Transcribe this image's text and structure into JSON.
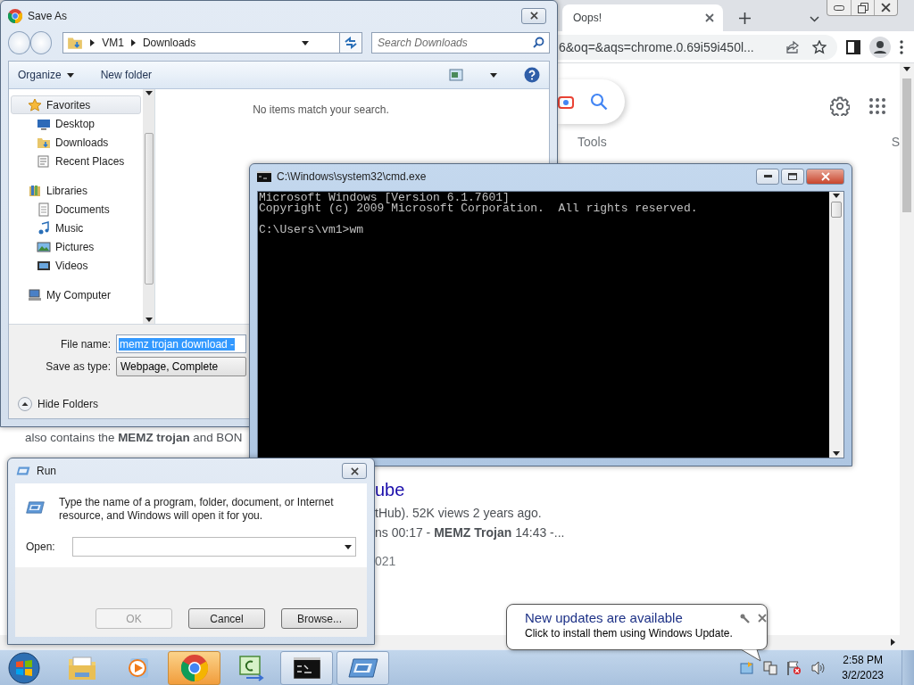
{
  "browser": {
    "tab": {
      "title": "Oops!"
    },
    "address": "6&oq=&aqs=chrome.0.69i59i450l...",
    "page": {
      "tools_link": "Tools",
      "cut_tab": "S",
      "snippet": "also contains the **MEMZ trojan** and BON",
      "result_title": "ube",
      "result_meta": "tHub). 52K views 2 years ago.",
      "result_chapters": "ns 00:17 - **MEMZ Trojan** 14:43 -...",
      "result_date": "021"
    }
  },
  "save_as": {
    "title": "Save As",
    "path": [
      "VM1",
      "Downloads"
    ],
    "search": {
      "placeholder": "Search Downloads"
    },
    "toolbar": {
      "organize": "Organize",
      "new_folder": "New folder"
    },
    "nav": [
      {
        "label": "Favorites",
        "kind": "favorites",
        "selected": true,
        "children": [
          {
            "label": "Desktop",
            "kind": "desktop",
            "selected": false
          },
          {
            "label": "Downloads",
            "kind": "downloads",
            "selected": false
          },
          {
            "label": "Recent Places",
            "kind": "recent",
            "selected": false
          }
        ]
      },
      {
        "label": "Libraries",
        "kind": "libraries",
        "selected": false,
        "children": [
          {
            "label": "Documents",
            "kind": "documents",
            "selected": false
          },
          {
            "label": "Music",
            "kind": "music",
            "selected": false
          },
          {
            "label": "Pictures",
            "kind": "pictures",
            "selected": false
          },
          {
            "label": "Videos",
            "kind": "videos",
            "selected": false
          }
        ]
      },
      {
        "label": "My Computer",
        "kind": "computer",
        "selected": false
      }
    ],
    "empty_message": "No items match your search.",
    "file_name": {
      "label": "File name:",
      "value": "memz trojan download -"
    },
    "save_type": {
      "label": "Save as type:",
      "value": "Webpage, Complete"
    },
    "hide_folders": "Hide Folders"
  },
  "console": {
    "title": "C:\\Windows\\system32\\cmd.exe",
    "banner": [
      "Microsoft Windows [Version 6.1.7601]",
      "Copyright (c) 2009 Microsoft Corporation.  All rights reserved."
    ],
    "prompt": "C:\\Users\\vm1>wm"
  },
  "run": {
    "title": "Run",
    "message": "Type the name of a program, folder, document, or Internet resource, and Windows will open it for you.",
    "open_label": "Open:",
    "buttons": [
      {
        "label": "OK",
        "disabled": true
      },
      {
        "label": "Cancel",
        "disabled": false
      },
      {
        "label": "Browse...",
        "disabled": false
      }
    ]
  },
  "notification": {
    "title": "New updates are available",
    "body": "Click to install them using Windows Update."
  },
  "taskbar": {
    "apps": [
      {
        "kind": "explorer",
        "open": false,
        "flashing": false
      },
      {
        "kind": "media",
        "open": false,
        "flashing": false
      },
      {
        "kind": "chrome",
        "open": true,
        "flashing": true
      },
      {
        "kind": "csharp",
        "open": false,
        "flashing": false
      },
      {
        "kind": "console",
        "open": true,
        "flashing": false
      },
      {
        "kind": "run",
        "open": true,
        "flashing": false
      }
    ],
    "clock": {
      "time": "2:58 PM",
      "date": "3/2/2023"
    }
  }
}
